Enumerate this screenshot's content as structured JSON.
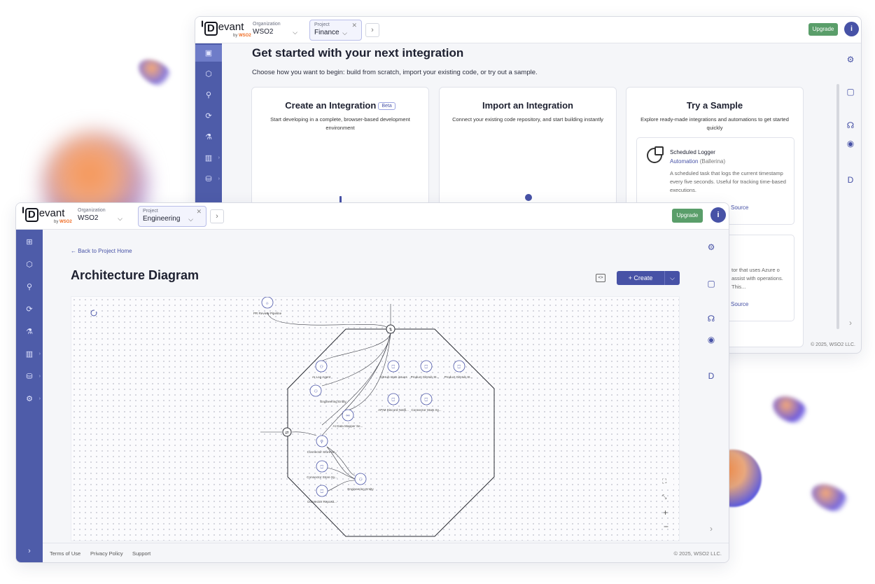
{
  "back_window": {
    "logo": {
      "text": "evant",
      "sub_prefix": "by",
      "sub_brand": "WSO2"
    },
    "org": {
      "label": "Organization",
      "value": "WSO2"
    },
    "project": {
      "label": "Project",
      "value": "Finance"
    },
    "upgrade": "Upgrade",
    "heading": "Get started with your next integration",
    "subheading": "Choose how you want to begin: build from scratch, import your existing code, or try out a sample.",
    "cards": [
      {
        "title": "Create an Integration",
        "badge": "Beta",
        "desc": "Start developing in a complete, browser-based development environment"
      },
      {
        "title": "Import an Integration",
        "desc": "Connect your existing code repository, and start building instantly"
      },
      {
        "title": "Try a Sample",
        "desc": "Explore ready-made integrations and automations to get started quickly"
      }
    ],
    "samples": [
      {
        "title": "Scheduled Logger",
        "kind": "Automation",
        "lang": "(Ballerina)",
        "desc": "A scheduled task that logs the current timestamp every five seconds. Useful for tracking time-based executions.",
        "link": "Source"
      },
      {
        "desc": "tor that uses Azure o assist with operations. This...",
        "link": "Source"
      }
    ],
    "copyright": "© 2025, WSO2 LLC."
  },
  "front_window": {
    "logo": {
      "text": "evant",
      "sub_prefix": "by",
      "sub_brand": "WSO2"
    },
    "org": {
      "label": "Organization",
      "value": "WSO2"
    },
    "project": {
      "label": "Project",
      "value": "Engineering"
    },
    "upgrade": "Upgrade",
    "back_link": "← Back to Project Home",
    "title": "Architecture Diagram",
    "create": "+ Create",
    "diagram_nodes": [
      "PR Review Pipeline",
      "AI Log Agent",
      "Engineering Entity",
      "AI Data Mapper Se...",
      "GitHub stats issues",
      "Product GitHub St...",
      "Product GitHub St...",
      "APIM Discord Notifi...",
      "Connector Stats Sy...",
      "Connector Store W...",
      "Connector Store Sy...",
      "Engineering Entity",
      "Connector Reposit..."
    ],
    "footer": {
      "terms": "Terms of Use",
      "privacy": "Privacy Policy",
      "support": "Support",
      "copyright": "© 2025, WSO2 LLC."
    }
  },
  "colors": {
    "primary": "#4752a6",
    "sidebar": "#4e5ca9",
    "upgrade": "#5a9e6a"
  }
}
